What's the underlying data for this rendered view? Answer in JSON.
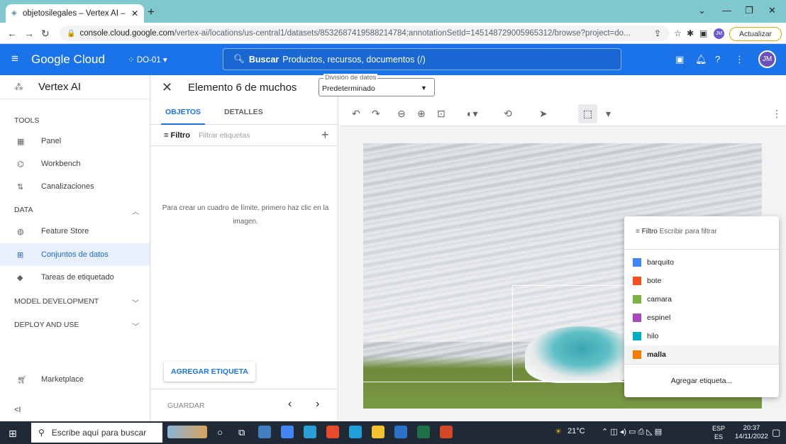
{
  "browser": {
    "tab_title": "objetosilegales – Vertex AI – DO-",
    "new_tab": "+",
    "url_host": "console.cloud.google.com",
    "url_path": "/vertex-ai/locations/us-central1/datasets/8532687419588214784;annotationSetId=145148729005965312/browse?project=do...",
    "profile_initials": "JM",
    "update_label": "Actualizar"
  },
  "gcp_header": {
    "brand": "Google Cloud",
    "project": "DO-01",
    "search_label": "Buscar",
    "search_placeholder": "Productos, recursos, documentos (/)",
    "avatar_initials": "JM"
  },
  "sidebar": {
    "app_name": "Vertex AI",
    "sections": {
      "tools": "TOOLS",
      "data": "DATA",
      "model_dev": "MODEL DEVELOPMENT",
      "deploy": "DEPLOY AND USE"
    },
    "items": {
      "panel": "Panel",
      "workbench": "Workbench",
      "pipelines": "Canalizaciones",
      "feature_store": "Feature Store",
      "datasets": "Conjuntos de datos",
      "labeling": "Tareas de etiquetado",
      "marketplace": "Marketplace"
    },
    "collapse": "<I"
  },
  "middle": {
    "title": "Elemento 6 de muchos",
    "tab_objects": "OBJETOS",
    "tab_details": "DETALLES",
    "filter_label": "Filtro",
    "filter_placeholder": "Filtrar etiquetas",
    "hint": "Para crear un cuadro de límite, primero haz clic en la imagen.",
    "add_label_button": "AGREGAR ETIQUETA",
    "save_button": "GUARDAR"
  },
  "data_split": {
    "label": "División de datos",
    "value": "Predeterminado"
  },
  "label_popup": {
    "filter_label": "Filtro",
    "filter_placeholder": "Escribir para filtrar",
    "labels": [
      {
        "name": "barquito",
        "color": "#4285f4"
      },
      {
        "name": "bote",
        "color": "#f4511e"
      },
      {
        "name": "camara",
        "color": "#7cb342"
      },
      {
        "name": "espinel",
        "color": "#ab47bc"
      },
      {
        "name": "hilo",
        "color": "#00acc1"
      },
      {
        "name": "malla",
        "color": "#f57c00"
      }
    ],
    "add_label": "Agregar etiqueta..."
  },
  "taskbar": {
    "search_placeholder": "Escribe aquí para buscar",
    "weather": "21°C",
    "lang_top": "ESP",
    "lang_bottom": "ES",
    "time": "20:37",
    "date": "14/11/2022"
  }
}
